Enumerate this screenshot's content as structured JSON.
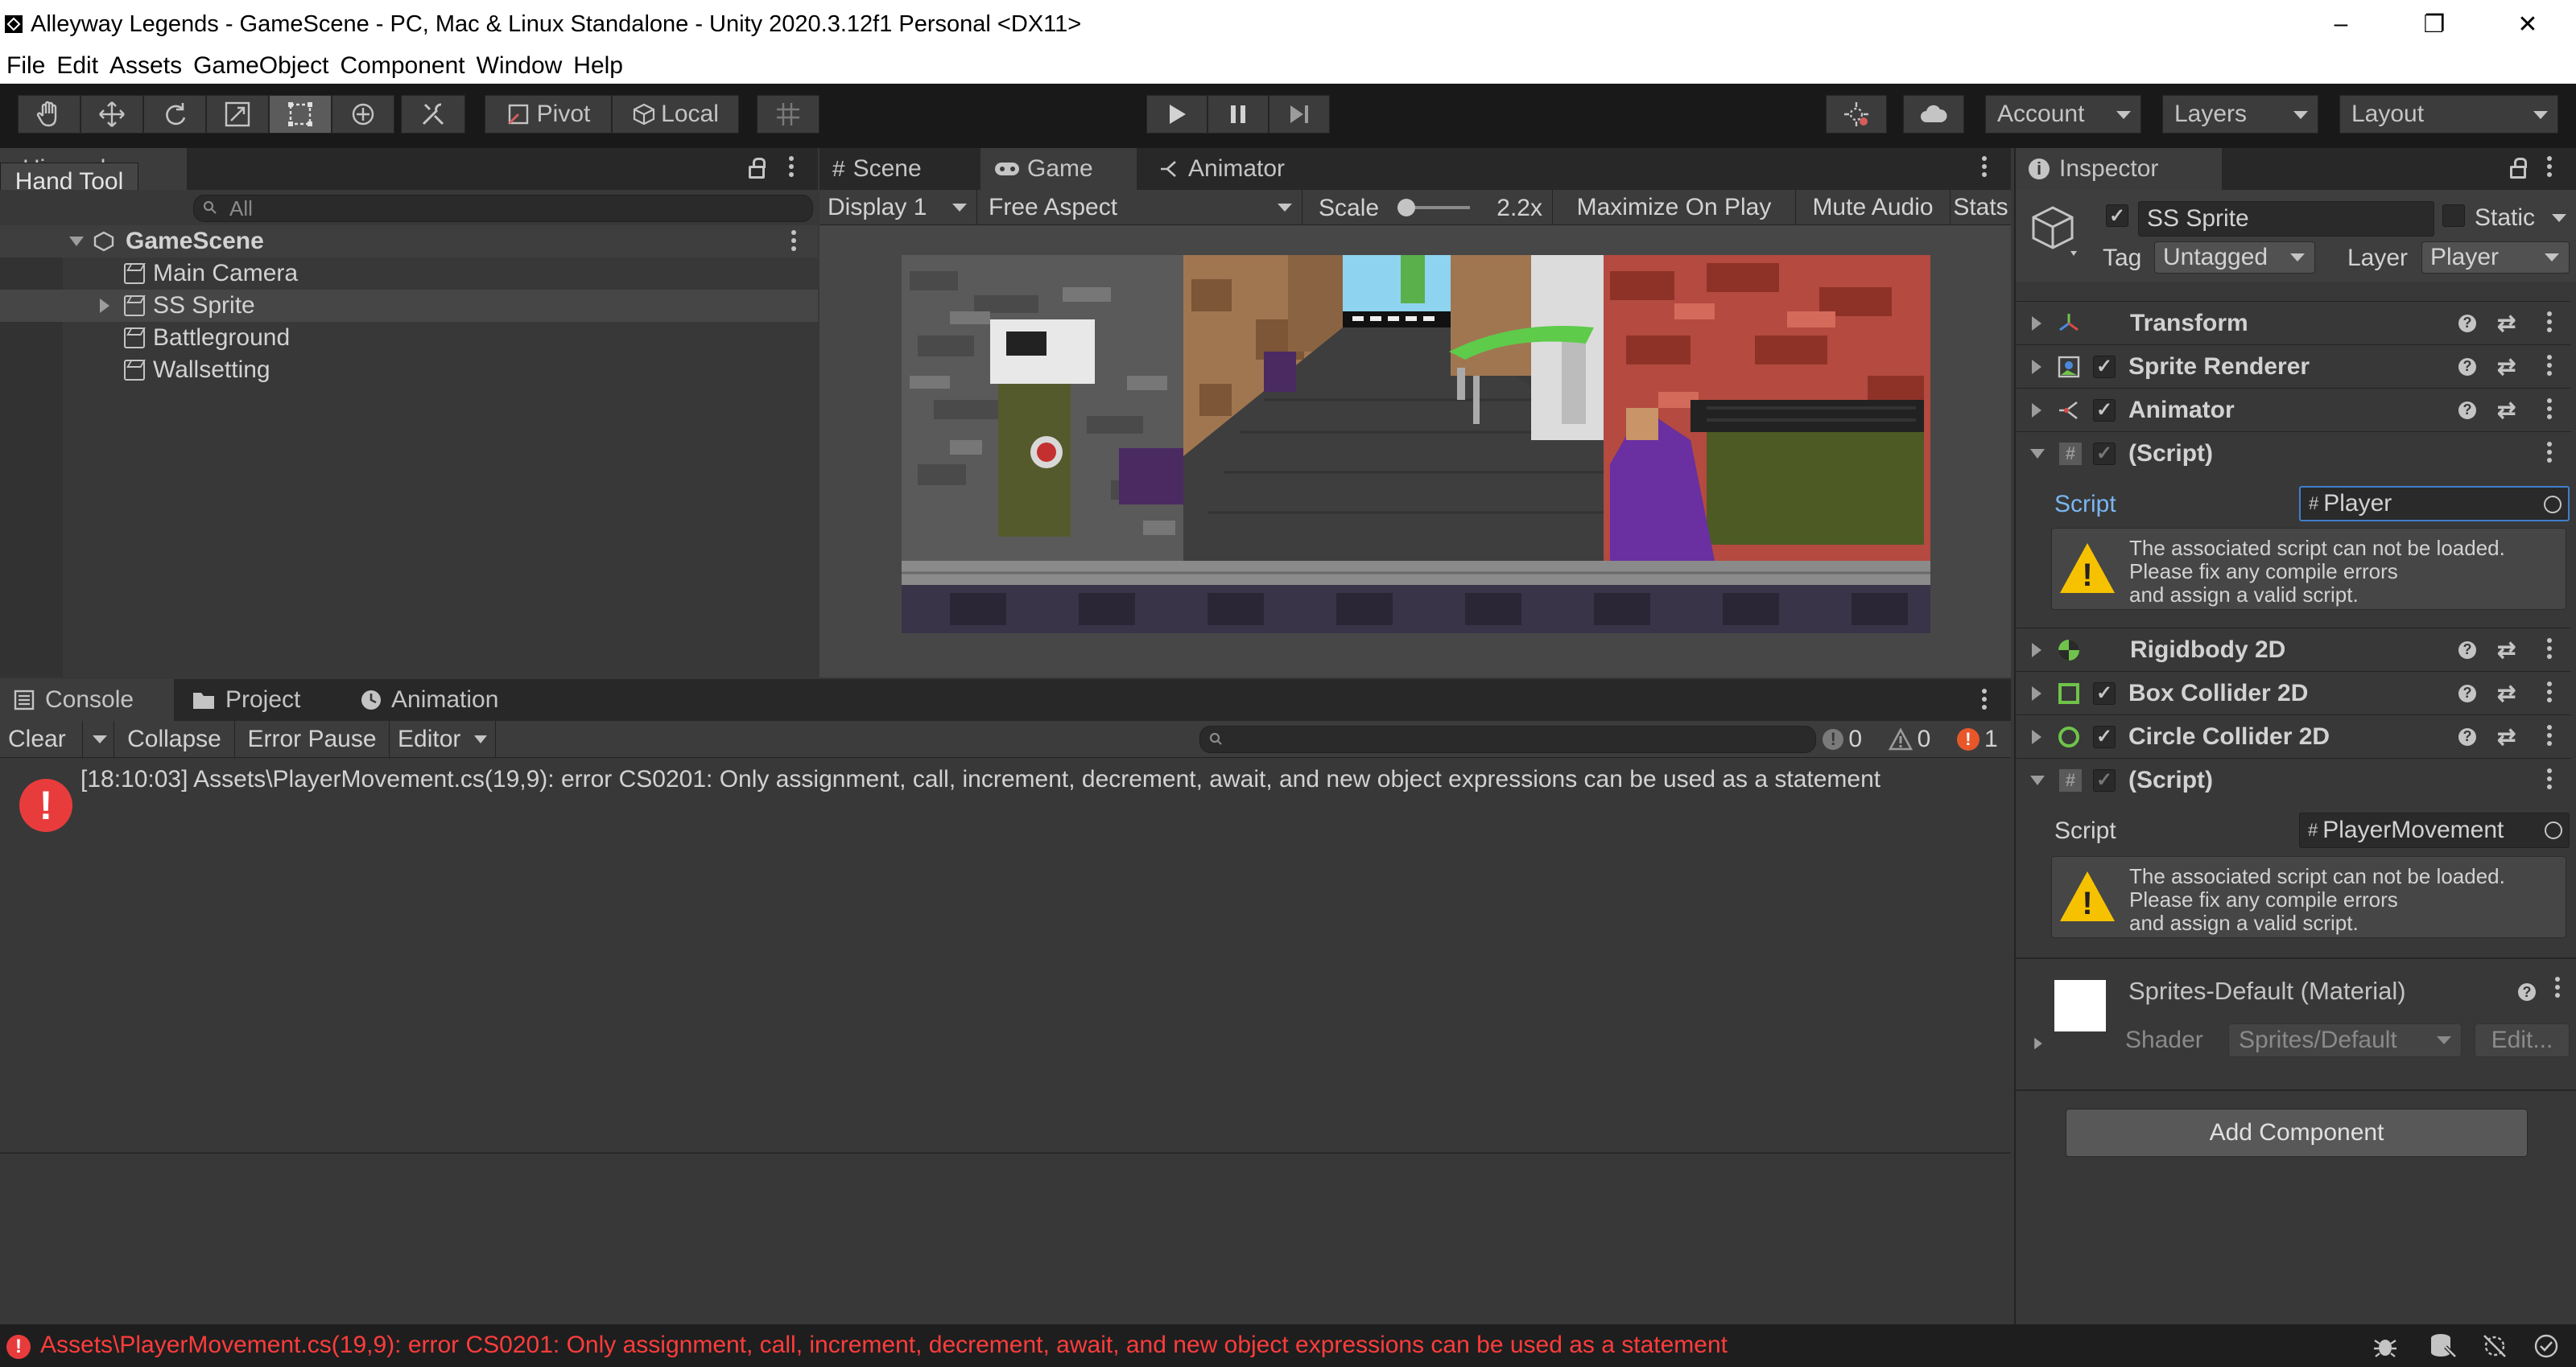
{
  "window": {
    "title": "Alleyway Legends - GameScene - PC, Mac & Linux Standalone - Unity 2020.3.12f1 Personal <DX11>",
    "minimize": "–",
    "restore": "❐",
    "close": "✕"
  },
  "menu": [
    "File",
    "Edit",
    "Assets",
    "GameObject",
    "Component",
    "Window",
    "Help"
  ],
  "toolbar": {
    "pivot_label": "Pivot",
    "local_label": "Local",
    "account_label": "Account",
    "layers_label": "Layers",
    "layout_label": "Layout",
    "tooltip": "Hand Tool"
  },
  "hierarchy": {
    "tab_label": "Hierarchy",
    "search_placeholder": "All",
    "scene": "GameScene",
    "items": [
      "Main Camera",
      "SS Sprite",
      "Battleground",
      "Wallsetting"
    ]
  },
  "game_view": {
    "tabs": [
      "Scene",
      "Game",
      "Animator"
    ],
    "display": "Display 1",
    "aspect": "Free Aspect",
    "scale_label": "Scale",
    "scale_value": "2.2x",
    "maximize": "Maximize On Play",
    "mute": "Mute Audio",
    "stats": "Stats"
  },
  "console": {
    "tabs": [
      "Console",
      "Project",
      "Animation"
    ],
    "clear": "Clear",
    "collapse": "Collapse",
    "error_pause": "Error Pause",
    "editor": "Editor",
    "log_count": "0",
    "warn_count": "0",
    "error_count": "1",
    "entry": "[18:10:03] Assets\\PlayerMovement.cs(19,9): error CS0201: Only assignment, call, increment, decrement, await, and new object expressions can be used as a statement"
  },
  "inspector": {
    "tab_label": "Inspector",
    "object_name": "SS Sprite",
    "static_label": "Static",
    "tag_label": "Tag",
    "tag_value": "Untagged",
    "layer_label": "Layer",
    "layer_value": "Player",
    "components": {
      "transform": "Transform",
      "sprite_renderer": "Sprite Renderer",
      "animator": "Animator",
      "script1": "(Script)",
      "rigidbody": "Rigidbody 2D",
      "box_collider": "Box Collider 2D",
      "circle_collider": "Circle Collider 2D",
      "script2": "(Script)"
    },
    "script_label": "Script",
    "script1_value": "Player",
    "script2_value": "PlayerMovement",
    "warning_lines": [
      "The associated script can not be loaded.",
      "Please fix any compile errors",
      "and assign a valid script."
    ],
    "material_name": "Sprites-Default (Material)",
    "shader_label": "Shader",
    "shader_value": "Sprites/Default",
    "edit_label": "Edit...",
    "add_component": "Add Component"
  },
  "status_bar": {
    "message": "Assets\\PlayerMovement.cs(19,9): error CS0201: Only assignment, call, increment, decrement, await, and new object expressions can be used as a statement"
  }
}
